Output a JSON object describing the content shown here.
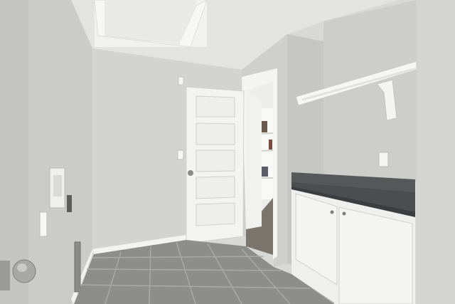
{
  "scene": {
    "kind": "photo",
    "subject": "laundry-room-interior",
    "colors": {
      "ceiling": "#e4e4e2",
      "wall_left": "#cfcfcd",
      "wall_back": "#d6d6d3",
      "wall_right": "#cacac7",
      "floor": "#8f8f8c",
      "grout": "#a6a6a3",
      "door": "#f2f2f0",
      "trim": "#f4f4f2",
      "countertop": "#4a4b4d",
      "cabinet": "#f0f0ee",
      "closet_floor": "#7d7670"
    }
  }
}
